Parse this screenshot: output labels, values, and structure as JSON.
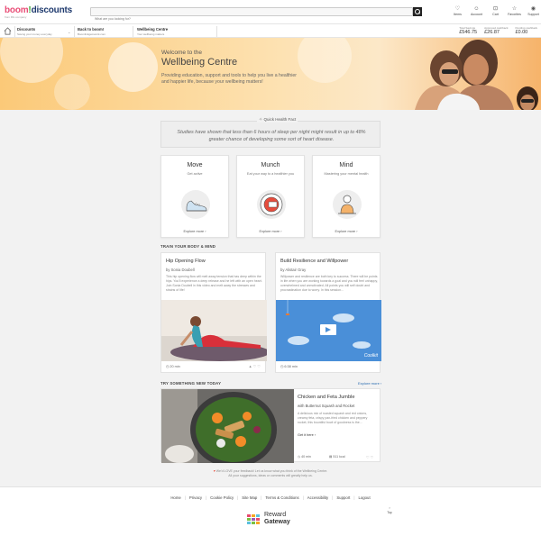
{
  "header": {
    "logo": {
      "part1": "boom",
      "part2": "!",
      "part3": "discounts"
    },
    "tagline": "from RG company",
    "search_placeholder": "What are you looking for?",
    "nav": [
      {
        "icon": "heart-icon",
        "glyph": "♡",
        "label": "Items"
      },
      {
        "icon": "account-icon",
        "glyph": "☺",
        "label": "Account"
      },
      {
        "icon": "cart-icon",
        "glyph": "⊡",
        "label": "Cart"
      },
      {
        "icon": "star-icon",
        "glyph": "☆",
        "label": "Favorites"
      },
      {
        "icon": "support-icon",
        "glyph": "◉",
        "label": "Support"
      }
    ]
  },
  "subnav": {
    "items": [
      {
        "title": "Discounts",
        "sub": "Saving your money everyday"
      },
      {
        "title": "Back to boom!",
        "sub": "Boomlinkgemwork.com"
      },
      {
        "title": "Wellbeing Centre",
        "sub": "Your wellbeing matters"
      }
    ],
    "stats": [
      {
        "label": "Total Savings",
        "value": "£546.75"
      },
      {
        "label": "Approved cashback",
        "value": "£26.87"
      },
      {
        "label": "Pending cashback",
        "value": "£0.00"
      }
    ]
  },
  "hero": {
    "eyebrow": "Welcome to the",
    "title": "Wellbeing Centre",
    "description": "Providing education, support and tools to help you live a healthier and happier life, because your wellbeing matters!"
  },
  "fact": {
    "label": "Quick Health Fact",
    "text": "Studies have shown that less than 6 hours of sleep per night might result in up to 48% greater chance of developing some sort of heart disease."
  },
  "pillars": [
    {
      "title": "Move",
      "sub": "Get active",
      "more": "Explore more"
    },
    {
      "title": "Munch",
      "sub": "Eat your way to a healthier you",
      "more": "Explore more"
    },
    {
      "title": "Mind",
      "sub": "Mastering your mental health",
      "more": "Explore more"
    }
  ],
  "train_heading": "TRAIN YOUR BODY & MIND",
  "articles": [
    {
      "title": "Hip Opening Flow",
      "by": "by Sonia Doubell",
      "desc": "This hip opening flow will melt away tension that has deep within the hips. You'll experience a deep release and he left with an open heart. Join Sonia Doubell in this video and melt away the stresses and strains of life!",
      "duration": "20 min"
    },
    {
      "title": "Build Resilience and Willpower",
      "by": "by Alistair Gray",
      "desc": "Willpower and resilience are both key to success. There will be points in life when you are working towards a goal and you will feel unhappy, overwhelmed and unmotivated. All points you will self doubt and procrastination due to worry. In this session...",
      "duration": "6:38 min",
      "video_brand": "Coolkit"
    }
  ],
  "try_heading": "TRY SOMETHING NEW TODAY",
  "explore_more": "Explore more",
  "recipe": {
    "title": "Chicken and Feta Jumble",
    "by": "with Butternut Squash and Rocket",
    "desc": "A delicious mix of roasted squash and red onions, creamy feta, crispy pan-fried chicken and peppery rocket, this bountiful bowl of goodness is the...",
    "link": "Get it here",
    "time": "40 min",
    "kcal": "511 kcal"
  },
  "feedback": {
    "line1": "We'd LOVE your feedback! Let us know what you think of the Wellbeing Centre.",
    "line2": "All your suggestions, ideas or comments will greatly help us."
  },
  "footer": {
    "links": [
      "Home",
      "Privacy",
      "Cookie Policy",
      "Site Map",
      "Terms & Conditions",
      "Accessibility",
      "Support",
      "Logout"
    ],
    "top": "Top",
    "brand1": "Reward",
    "brand2": "Gateway"
  }
}
